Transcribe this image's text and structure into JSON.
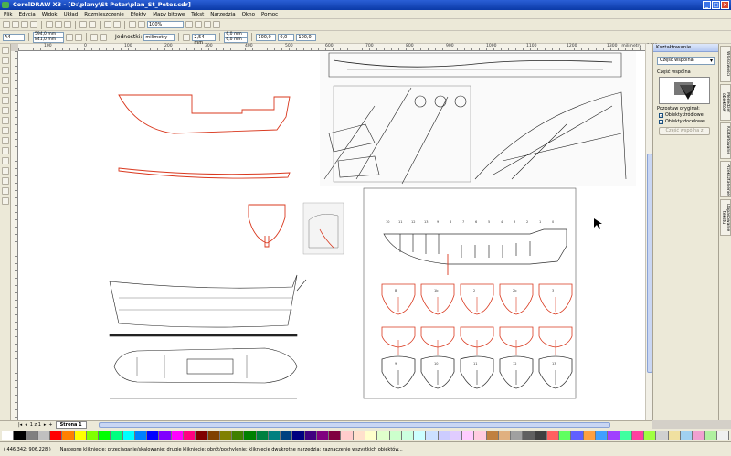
{
  "window": {
    "title": "CorelDRAW X3 - [D:\\plany\\St Peter\\plan_St_Peter.cdr]"
  },
  "menu": [
    "Plik",
    "Edycja",
    "Widok",
    "Układ",
    "Rozmieszczenie",
    "Efekty",
    "Mapy bitowe",
    "Tekst",
    "Narzędzia",
    "Okno",
    "Pomoc"
  ],
  "toolbar": {
    "paper_size": "A4",
    "width": "594,0 mm",
    "height": "841,0 mm",
    "zoom": "100%",
    "units": "milimetry",
    "nudge": "2,54 mm",
    "dup_x": "6,0 mm",
    "dup_y": "6,0 mm",
    "scale_x": "100,0",
    "scale_y": "100,0",
    "angle": "0,0",
    "unit_label": "Jednostki:"
  },
  "ruler": {
    "unit": "milimetry",
    "ticks": [
      "100",
      "0",
      "100",
      "200",
      "300",
      "400",
      "500",
      "600",
      "700",
      "800",
      "900",
      "1000",
      "1100",
      "1200",
      "1300",
      "1400"
    ]
  },
  "pages": {
    "nav": "1 z 1",
    "tab": "Strona 1"
  },
  "docker": {
    "title": "Kształtowanie",
    "mode": "Część wspólna",
    "section_label": "Część wspólna",
    "keep_label": "Pozostaw oryginał:",
    "opt_source": "Obiekty źródłowe",
    "opt_target": "Obiekty docelowe",
    "apply": "Część wspólna z"
  },
  "side_tabs": [
    "Właściwości",
    "Menedżer obiektów",
    "Kształtowanie",
    "Przekształcenie",
    "Dopasowanie tekstu"
  ],
  "status": {
    "coords": "( 446,342; 906,228 )",
    "hint": "Następne kliknięcie: przeciąganie/skalowanie; drugie kliknięcie: obrót/pochylenie; kliknięcie dwukrotne narzędzia: zaznaczenie wszystkich obiektów..."
  },
  "drawing": {
    "frame_labels": [
      "B",
      "1b",
      "2",
      "2b",
      "3"
    ],
    "frame_labels_2": [
      "",
      "",
      "",
      "",
      ""
    ],
    "frame_labels_3": [
      "9",
      "10",
      "11",
      "12",
      "13"
    ],
    "deck_numbers": [
      "10",
      "11",
      "12",
      "13",
      "9",
      "8",
      "7",
      "6",
      "5",
      "4",
      "3",
      "2",
      "1",
      "0"
    ]
  },
  "palette": [
    "#ffffff",
    "#000000",
    "#808080",
    "#c0c0c0",
    "#ff0000",
    "#ff8000",
    "#ffff00",
    "#80ff00",
    "#00ff00",
    "#00ff80",
    "#00ffff",
    "#0080ff",
    "#0000ff",
    "#8000ff",
    "#ff00ff",
    "#ff0080",
    "#800000",
    "#804000",
    "#808000",
    "#408000",
    "#008000",
    "#008040",
    "#008080",
    "#004080",
    "#000080",
    "#400080",
    "#800080",
    "#800040",
    "#ffcccc",
    "#ffe0cc",
    "#ffffcc",
    "#e0ffcc",
    "#ccffcc",
    "#ccffe0",
    "#ccffff",
    "#cce0ff",
    "#ccccff",
    "#e0ccff",
    "#ffccff",
    "#ffcce0",
    "#c08040",
    "#e0b080",
    "#a0a0a0",
    "#606060",
    "#404040",
    "#ff6060",
    "#60ff60",
    "#6060ff",
    "#ffa040",
    "#40a0ff",
    "#a040ff",
    "#40ffa0",
    "#ff40a0",
    "#a0ff40",
    "#d0d0d0",
    "#f0e0a0",
    "#a0d0f0",
    "#f0a0d0",
    "#b0f0a0",
    "#f0f0f0"
  ]
}
